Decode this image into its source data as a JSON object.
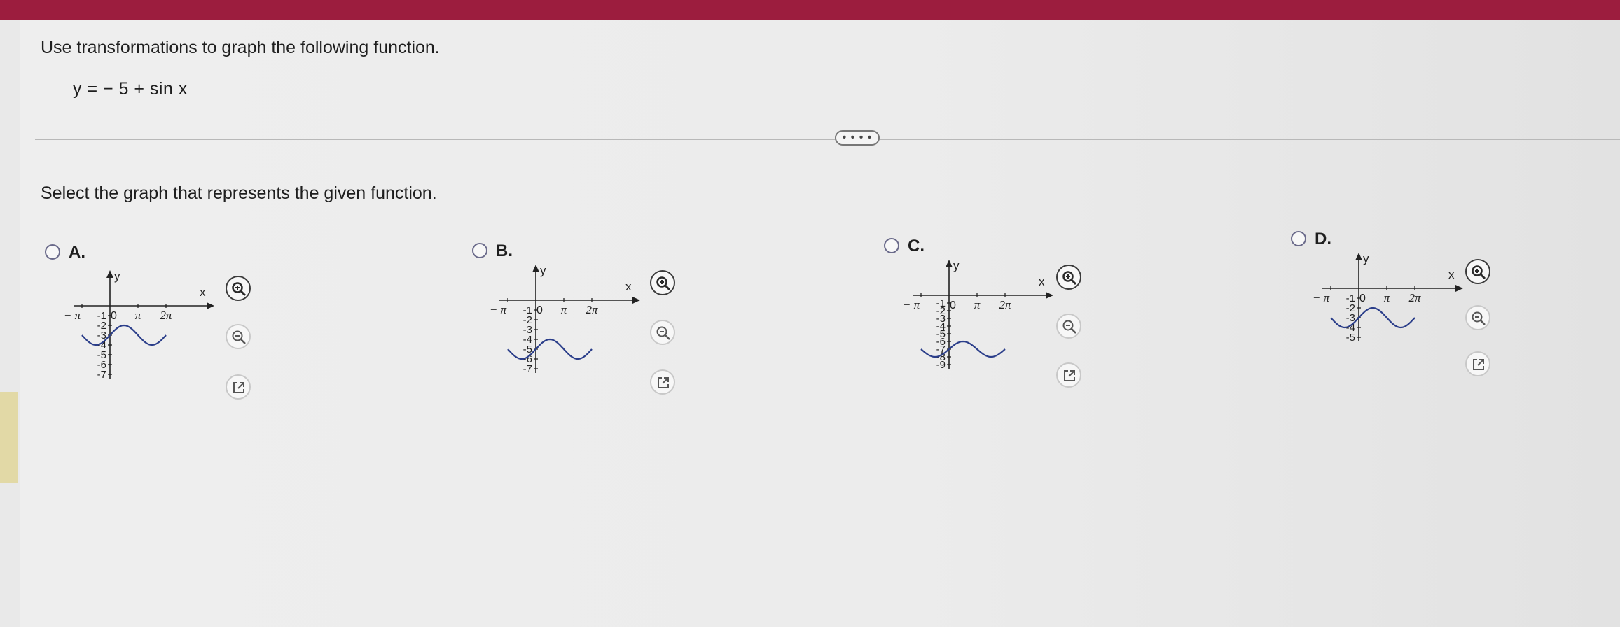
{
  "question": "Use transformations to graph the following function.",
  "function": "y = − 5 + sin x",
  "more_label": "• • • •",
  "select_prompt": "Select the graph that represents the given function.",
  "options": [
    {
      "label": "A."
    },
    {
      "label": "B."
    },
    {
      "label": "C."
    },
    {
      "label": "D."
    }
  ],
  "axis": {
    "y_label": "y",
    "x_label": "x",
    "x_ticks": [
      "− π",
      "π",
      "2π"
    ]
  },
  "graphs": [
    {
      "y_ticks": [
        "-1",
        "-2",
        "-3",
        "-4",
        "-5",
        "-6",
        "-7"
      ],
      "origin_label": "0"
    },
    {
      "y_ticks": [
        "-1",
        "-2",
        "-3",
        "-4",
        "-5",
        "-6",
        "-7"
      ],
      "origin_label": "0"
    },
    {
      "y_ticks": [
        "-1",
        "-2",
        "-3",
        "-4",
        "-5",
        "-6",
        "-7",
        "-8",
        "-9"
      ],
      "origin_label": "0"
    },
    {
      "y_ticks": [
        "-1",
        "-2",
        "-3",
        "-4",
        "-5"
      ],
      "origin_label": "0"
    }
  ],
  "icons": {
    "zoom_in": "zoom-in-icon",
    "zoom_out": "zoom-out-icon",
    "popout": "popout-icon"
  }
}
